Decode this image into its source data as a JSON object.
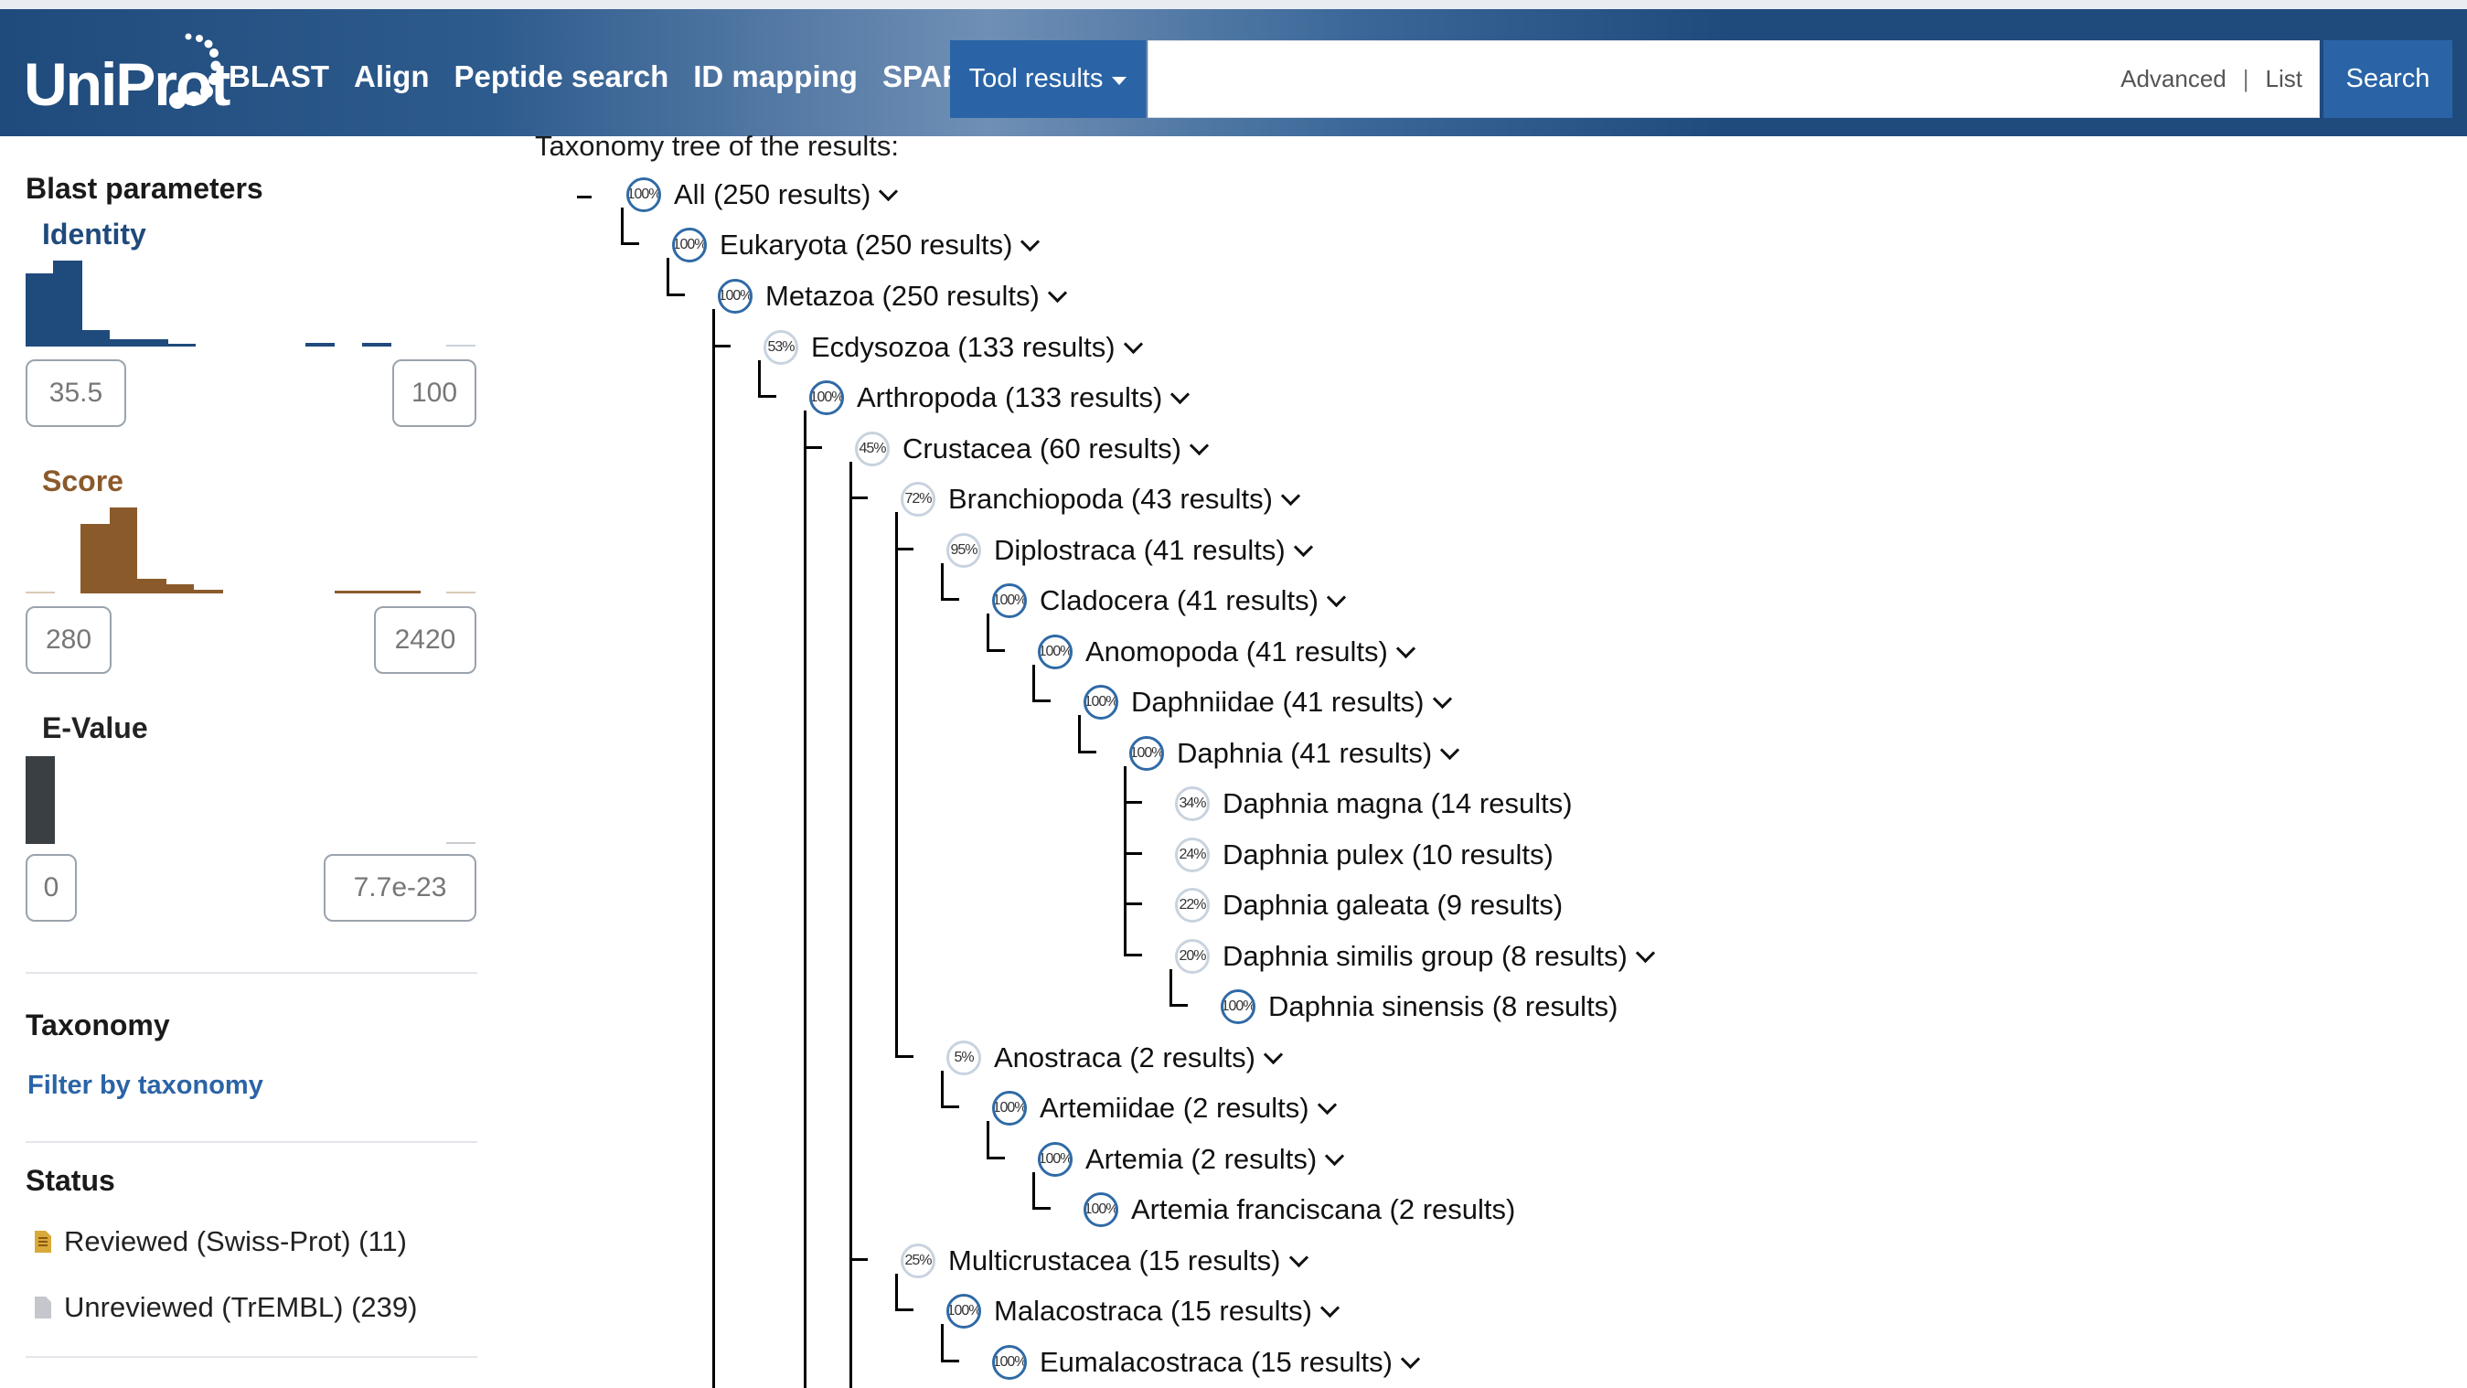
{
  "header": {
    "logo_text": "UniProt",
    "nav": [
      "BLAST",
      "Align",
      "Peptide search",
      "ID mapping",
      "SPARQL"
    ],
    "tool_results_label": "Tool results",
    "search_placeholder": "",
    "advanced_label": "Advanced",
    "list_label": "List",
    "search_button": "Search",
    "colors": {
      "header_bg": "#1f4a7c",
      "button_bg": "#2a64a6"
    }
  },
  "sidebar": {
    "blast_params_title": "Blast parameters",
    "identity": {
      "label": "Identity",
      "min": "35.5",
      "max": "100",
      "color": "#1f4a7c"
    },
    "score": {
      "label": "Score",
      "min": "280",
      "max": "2420",
      "color": "#8b5a2b"
    },
    "evalue": {
      "label": "E-Value",
      "min": "0",
      "max": "7.7e-23",
      "color": "#3a3f44"
    },
    "taxonomy_title": "Taxonomy",
    "filter_link": "Filter by taxonomy",
    "status_title": "Status",
    "status_items": [
      {
        "label": "Reviewed (Swiss-Prot) (11)",
        "icon": "reviewed-doc-icon"
      },
      {
        "label": "Unreviewed (TrEMBL) (239)",
        "icon": "unreviewed-doc-icon"
      }
    ]
  },
  "tree": {
    "heading": "Taxonomy tree of the results:",
    "nodes": [
      {
        "pct": "100%",
        "label": "All (250 results)",
        "expand": true
      },
      {
        "pct": "100%",
        "label": "Eukaryota (250 results)",
        "expand": true
      },
      {
        "pct": "100%",
        "label": "Metazoa (250 results)",
        "expand": true
      },
      {
        "pct": "53%",
        "label": "Ecdysozoa (133 results)",
        "expand": true
      },
      {
        "pct": "100%",
        "label": "Arthropoda (133 results)",
        "expand": true
      },
      {
        "pct": "45%",
        "label": "Crustacea (60 results)",
        "expand": true
      },
      {
        "pct": "72%",
        "label": "Branchiopoda (43 results)",
        "expand": true
      },
      {
        "pct": "95%",
        "label": "Diplostraca (41 results)",
        "expand": true
      },
      {
        "pct": "100%",
        "label": "Cladocera (41 results)",
        "expand": true
      },
      {
        "pct": "100%",
        "label": "Anomopoda (41 results)",
        "expand": true
      },
      {
        "pct": "100%",
        "label": "Daphniidae (41 results)",
        "expand": true
      },
      {
        "pct": "100%",
        "label": "Daphnia (41 results)",
        "expand": true
      },
      {
        "pct": "34%",
        "label": "Daphnia magna (14 results)",
        "expand": false
      },
      {
        "pct": "24%",
        "label": "Daphnia pulex (10 results)",
        "expand": false
      },
      {
        "pct": "22%",
        "label": "Daphnia galeata (9 results)",
        "expand": false
      },
      {
        "pct": "20%",
        "label": "Daphnia similis group (8 results)",
        "expand": true
      },
      {
        "pct": "100%",
        "label": "Daphnia sinensis (8 results)",
        "expand": false
      },
      {
        "pct": "5%",
        "label": "Anostraca (2 results)",
        "expand": true
      },
      {
        "pct": "100%",
        "label": "Artemiidae (2 results)",
        "expand": true
      },
      {
        "pct": "100%",
        "label": "Artemia (2 results)",
        "expand": true
      },
      {
        "pct": "100%",
        "label": "Artemia franciscana (2 results)",
        "expand": false
      },
      {
        "pct": "25%",
        "label": "Multicrustacea (15 results)",
        "expand": true
      },
      {
        "pct": "100%",
        "label": "Malacostraca (15 results)",
        "expand": true
      },
      {
        "pct": "100%",
        "label": "Eumalacostraca (15 results)",
        "expand": true
      }
    ]
  }
}
